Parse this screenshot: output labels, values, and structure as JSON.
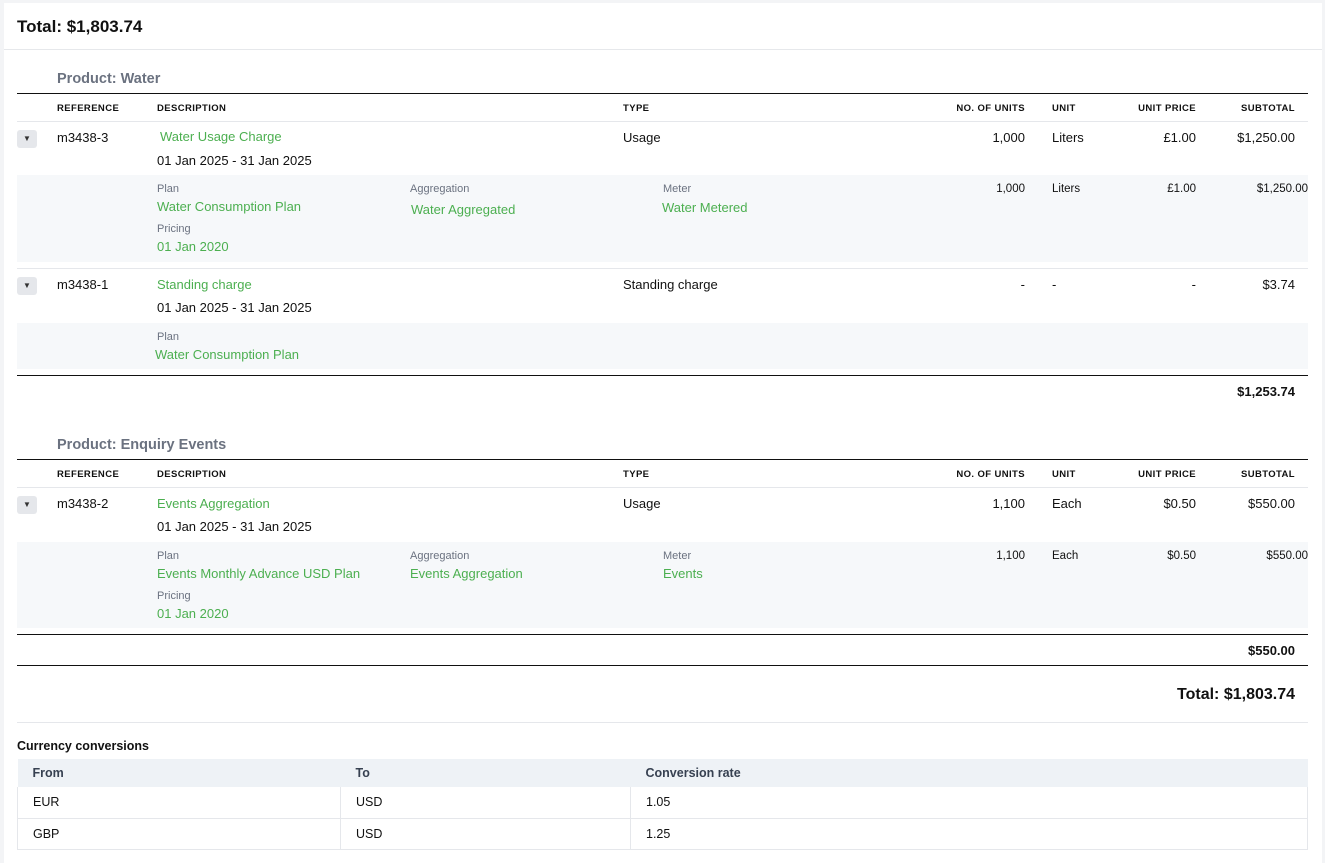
{
  "header": {
    "total": "Total: $1,803.74"
  },
  "columns": {
    "reference": "REFERENCE",
    "description": "DESCRIPTION",
    "type": "TYPE",
    "units": "NO. OF UNITS",
    "unit": "UNIT",
    "unit_price": "UNIT PRICE",
    "subtotal": "SUBTOTAL"
  },
  "labels": {
    "plan": "Plan",
    "aggregation": "Aggregation",
    "meter": "Meter",
    "pricing": "Pricing"
  },
  "products": [
    {
      "title": "Product: Water",
      "subtotal": "$1,253.74",
      "items": [
        {
          "reference": "m3438-3",
          "description": "Water Usage Charge",
          "period": "01 Jan 2025 - 31 Jan 2025",
          "type": "Usage",
          "units": "1,000",
          "unit": "Liters",
          "unit_price": "£1.00",
          "subtotal": "$1,250.00",
          "detail": {
            "plan": "Water Consumption Plan",
            "aggregation": "Water Aggregated",
            "meter": "Water Metered",
            "pricing": "01 Jan 2020",
            "units": "1,000",
            "unit": "Liters",
            "unit_price": "£1.00",
            "subtotal": "$1,250.00"
          }
        },
        {
          "reference": "m3438-1",
          "description": "Standing charge",
          "period": "01 Jan 2025 - 31 Jan 2025",
          "type": "Standing charge",
          "units": "-",
          "unit": "-",
          "unit_price": "-",
          "subtotal": "$3.74",
          "detail": {
            "plan": "Water Consumption Plan"
          }
        }
      ]
    },
    {
      "title": "Product: Enquiry Events",
      "subtotal": "$550.00",
      "items": [
        {
          "reference": "m3438-2",
          "description": "Events Aggregation",
          "period": "01 Jan 2025 - 31 Jan 2025",
          "type": "Usage",
          "units": "1,100",
          "unit": "Each",
          "unit_price": "$0.50",
          "subtotal": "$550.00",
          "detail": {
            "plan": "Events Monthly Advance USD Plan",
            "aggregation": "Events Aggregation",
            "meter": "Events",
            "pricing": "01 Jan 2020",
            "units": "1,100",
            "unit": "Each",
            "unit_price": "$0.50",
            "subtotal": "$550.00"
          }
        }
      ]
    }
  ],
  "grand_total": "Total: $1,803.74",
  "currency": {
    "title": "Currency conversions",
    "headers": [
      "From",
      "To",
      "Conversion rate"
    ],
    "rows": [
      [
        "EUR",
        "USD",
        "1.05"
      ],
      [
        "GBP",
        "USD",
        "1.25"
      ]
    ]
  },
  "colors": {
    "link": "#4caf50",
    "muted": "#6b7280",
    "detail_bg": "#f6f8fa"
  },
  "icons": {
    "expander": "chevron-down-icon"
  }
}
